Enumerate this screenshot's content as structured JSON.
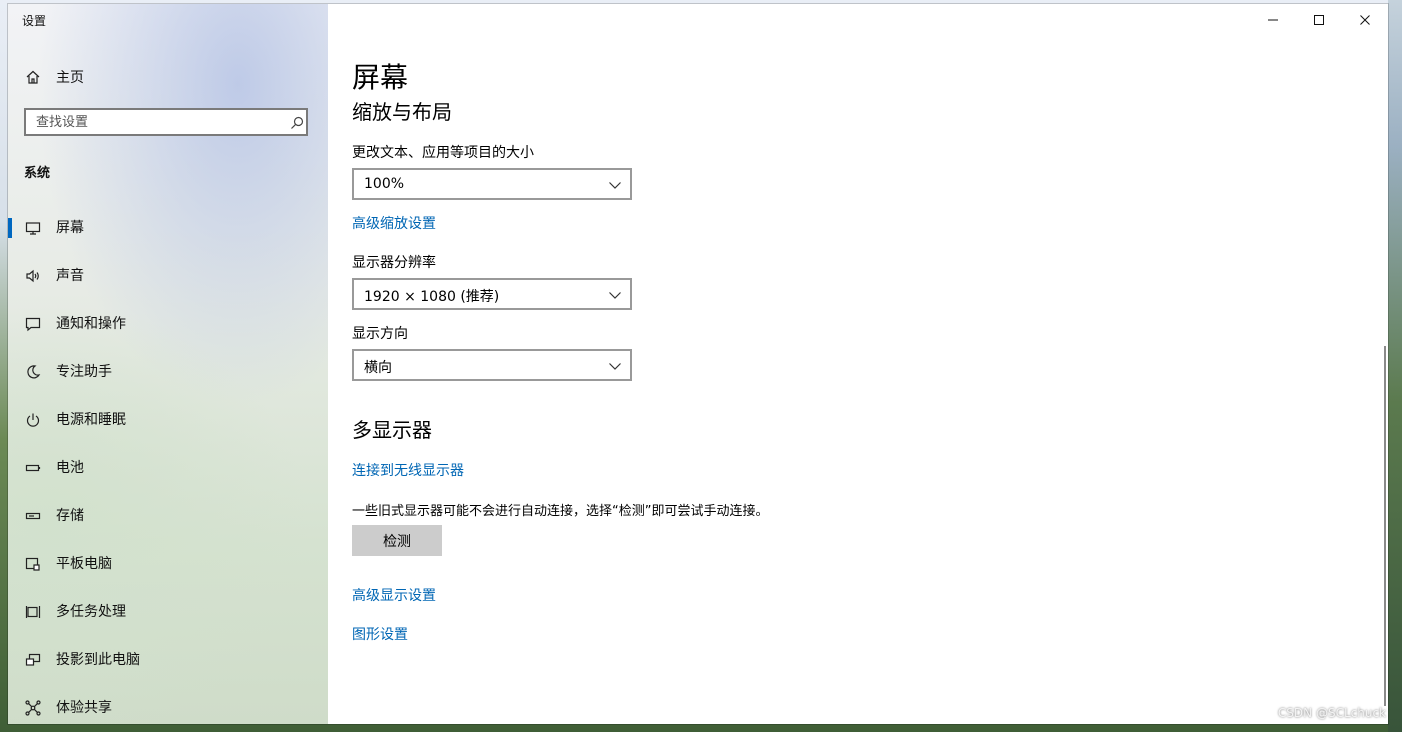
{
  "window": {
    "title": "设置"
  },
  "titlebar": {
    "minimize": "—",
    "maximize": "☐",
    "close": "✕"
  },
  "sidebar": {
    "home_label": "主页",
    "search_placeholder": "查找设置",
    "group_label": "系统",
    "items": [
      {
        "label": "屏幕",
        "icon": "monitor-icon",
        "active": true
      },
      {
        "label": "声音",
        "icon": "speaker-icon"
      },
      {
        "label": "通知和操作",
        "icon": "notification-icon"
      },
      {
        "label": "专注助手",
        "icon": "moon-icon"
      },
      {
        "label": "电源和睡眠",
        "icon": "power-icon"
      },
      {
        "label": "电池",
        "icon": "battery-icon"
      },
      {
        "label": "存储",
        "icon": "storage-icon"
      },
      {
        "label": "平板电脑",
        "icon": "tablet-icon"
      },
      {
        "label": "多任务处理",
        "icon": "multitask-icon"
      },
      {
        "label": "投影到此电脑",
        "icon": "project-icon"
      },
      {
        "label": "体验共享",
        "icon": "share-icon"
      }
    ]
  },
  "main": {
    "page_title": "屏幕",
    "scale_section": {
      "title": "缩放与布局",
      "text_size_label": "更改文本、应用等项目的大小",
      "text_size_value": "100%",
      "advanced_scaling_link": "高级缩放设置",
      "resolution_label": "显示器分辨率",
      "resolution_value": "1920 × 1080 (推荐)",
      "orientation_label": "显示方向",
      "orientation_value": "横向"
    },
    "multi_display": {
      "title": "多显示器",
      "wireless_link": "连接到无线显示器",
      "description": "一些旧式显示器可能不会进行自动连接，选择“检测”即可尝试手动连接。",
      "detect_button": "检测",
      "advanced_display_link": "高级显示设置",
      "graphics_link": "图形设置"
    }
  },
  "watermark": "CSDN @SCLchuck"
}
